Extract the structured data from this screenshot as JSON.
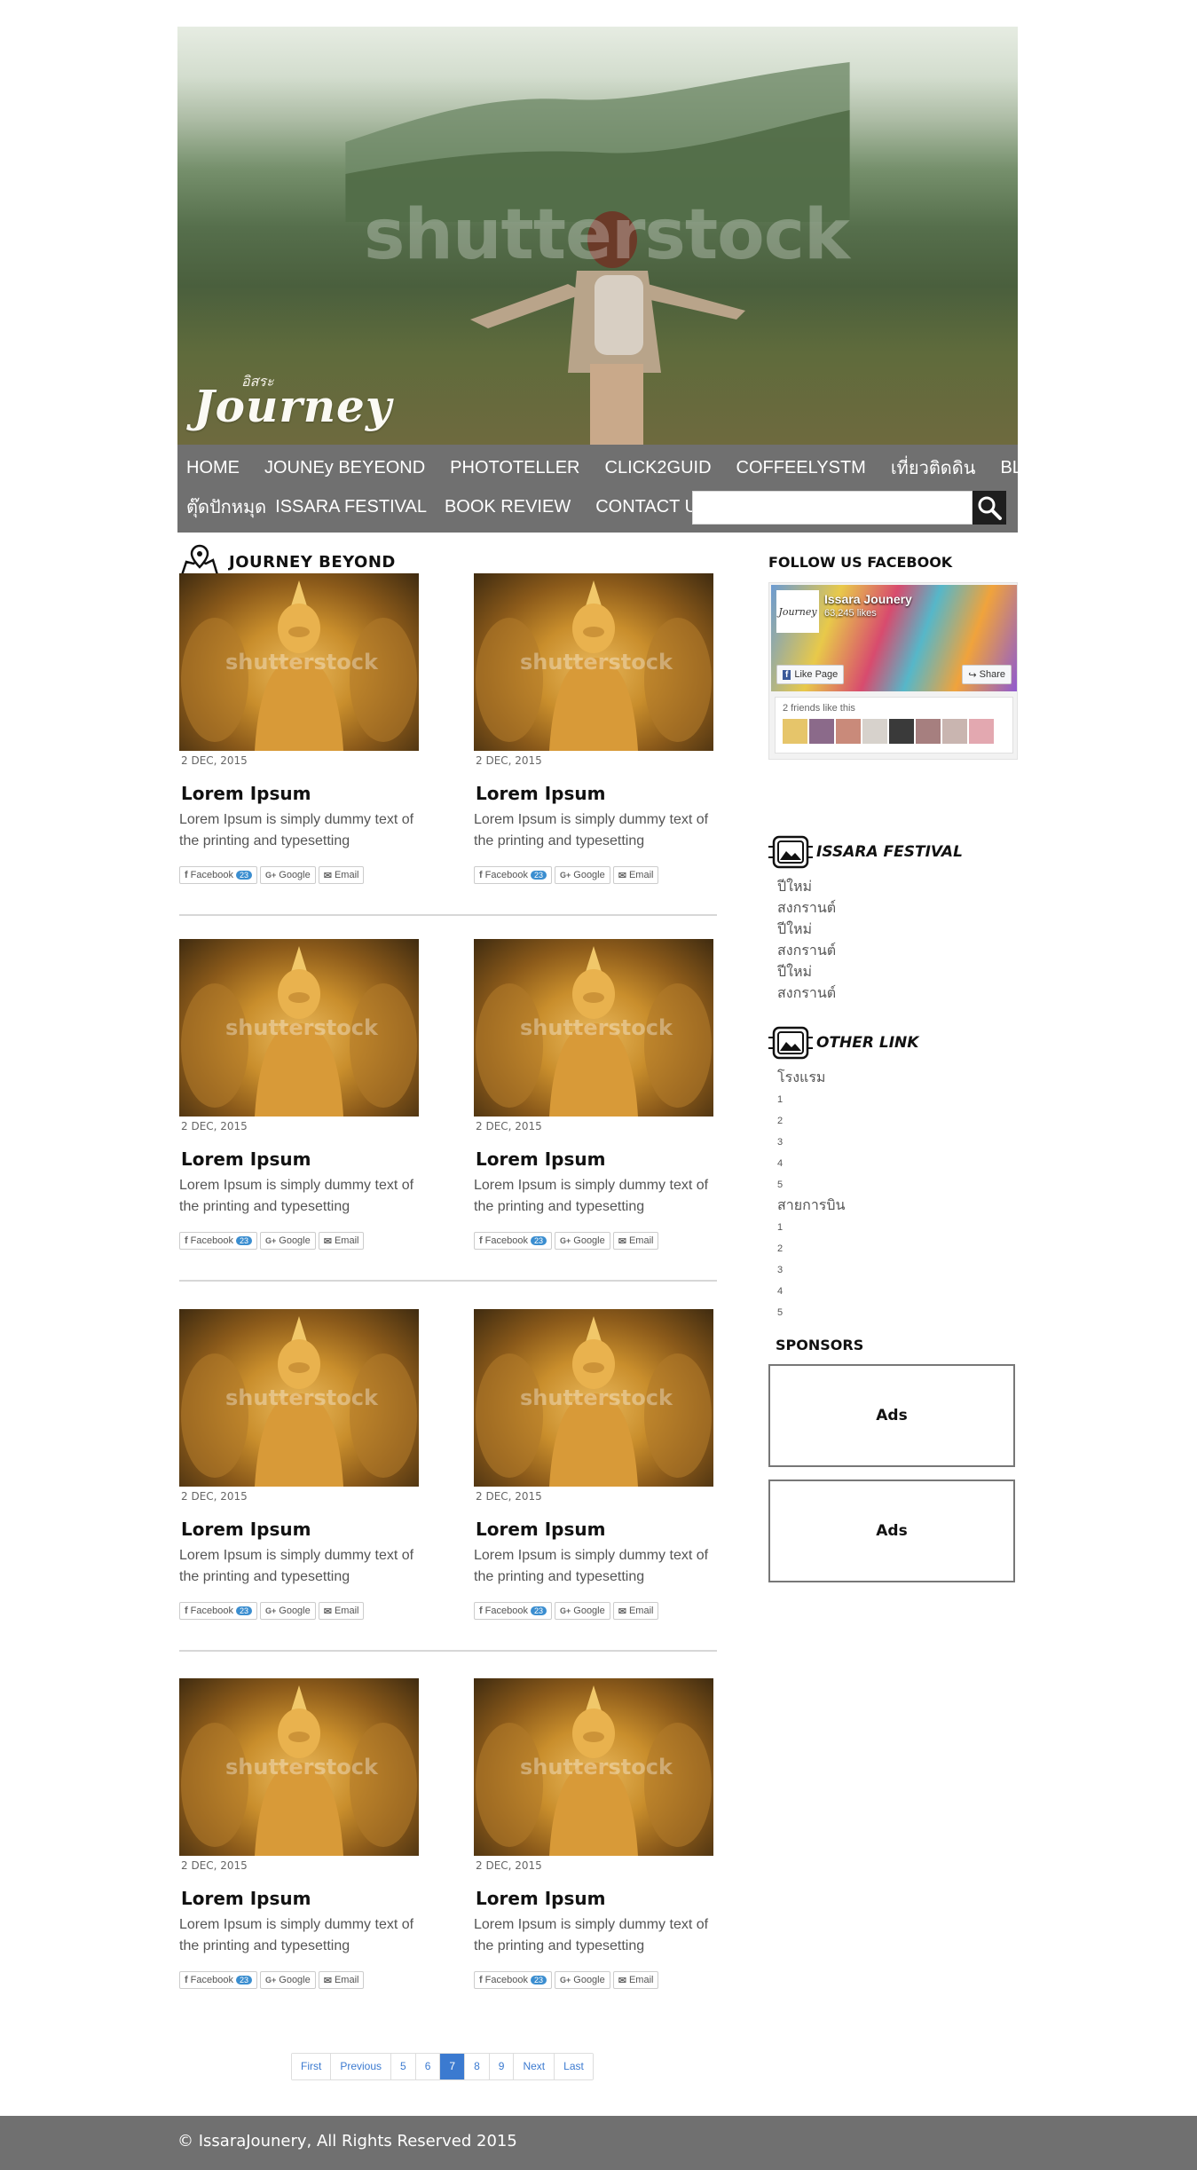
{
  "hero": {
    "watermark": "shutterstock",
    "logo_small": "อิสระ",
    "logo": "Journey"
  },
  "nav": {
    "row1": [
      "HOME",
      "JOUNEy BEYEOND",
      "PHOTOTELLER",
      "CLICK2GUID",
      "COFFEELYSTM",
      "เที่ยวติดดิน",
      "BLOG"
    ],
    "row2": [
      "ตุ๊ดปักหมุด",
      "ISSARA FESTIVAL",
      "BOOK REVIEW",
      "CONTACT US"
    ],
    "search_placeholder": ""
  },
  "main": {
    "section_title": "JOURNEY BEYOND",
    "thumb_watermark": "shutterstock",
    "post": {
      "date": "2  DEC, 2015",
      "title": "Lorem  Ipsum",
      "excerpt": "Lorem Ipsum is simply dummy text of the printing and typesetting"
    },
    "share": {
      "facebook": "Facebook",
      "facebook_count": "23",
      "google": "Google",
      "email": "Email"
    }
  },
  "pagination": [
    "First",
    "Previous",
    "5",
    "6",
    "7",
    "8",
    "9",
    "Next",
    "Last"
  ],
  "pagination_active": "7",
  "sidebar": {
    "facebook_title": "FOLLOW  US  FACEBOOK",
    "fb_page_name": "Issara Jounery",
    "fb_likes": "63,245 likes",
    "fb_like_page": "Like Page",
    "fb_share": "Share",
    "fb_friends": "2 friends like this",
    "festival_title": "ISSARA  FESTIVAL",
    "festival_items": [
      "ปีใหม่",
      "สงกรานต์",
      "ปีใหม่",
      "สงกรานต์",
      "ปีใหม่",
      "สงกรานต์"
    ],
    "other_title": "OTHER  LINK",
    "hotel_label": "โรงแรม",
    "hotel_items": [
      "1",
      "2",
      "3",
      "4",
      "5"
    ],
    "airline_label": "สายการบิน",
    "airline_items": [
      "1",
      "2",
      "3",
      "4",
      "5"
    ],
    "sponsors_title": "SPONSORS",
    "ads": [
      "Ads",
      "Ads"
    ]
  },
  "footer": {
    "copyright": "©  IssaraJounery,  All  Rights  Reserved  2015"
  },
  "colors": {
    "nav_bg": "#707070",
    "footer_bg": "#707070",
    "pager_accent": "#3b7ad0",
    "share_badge": "#3b8ed0"
  }
}
